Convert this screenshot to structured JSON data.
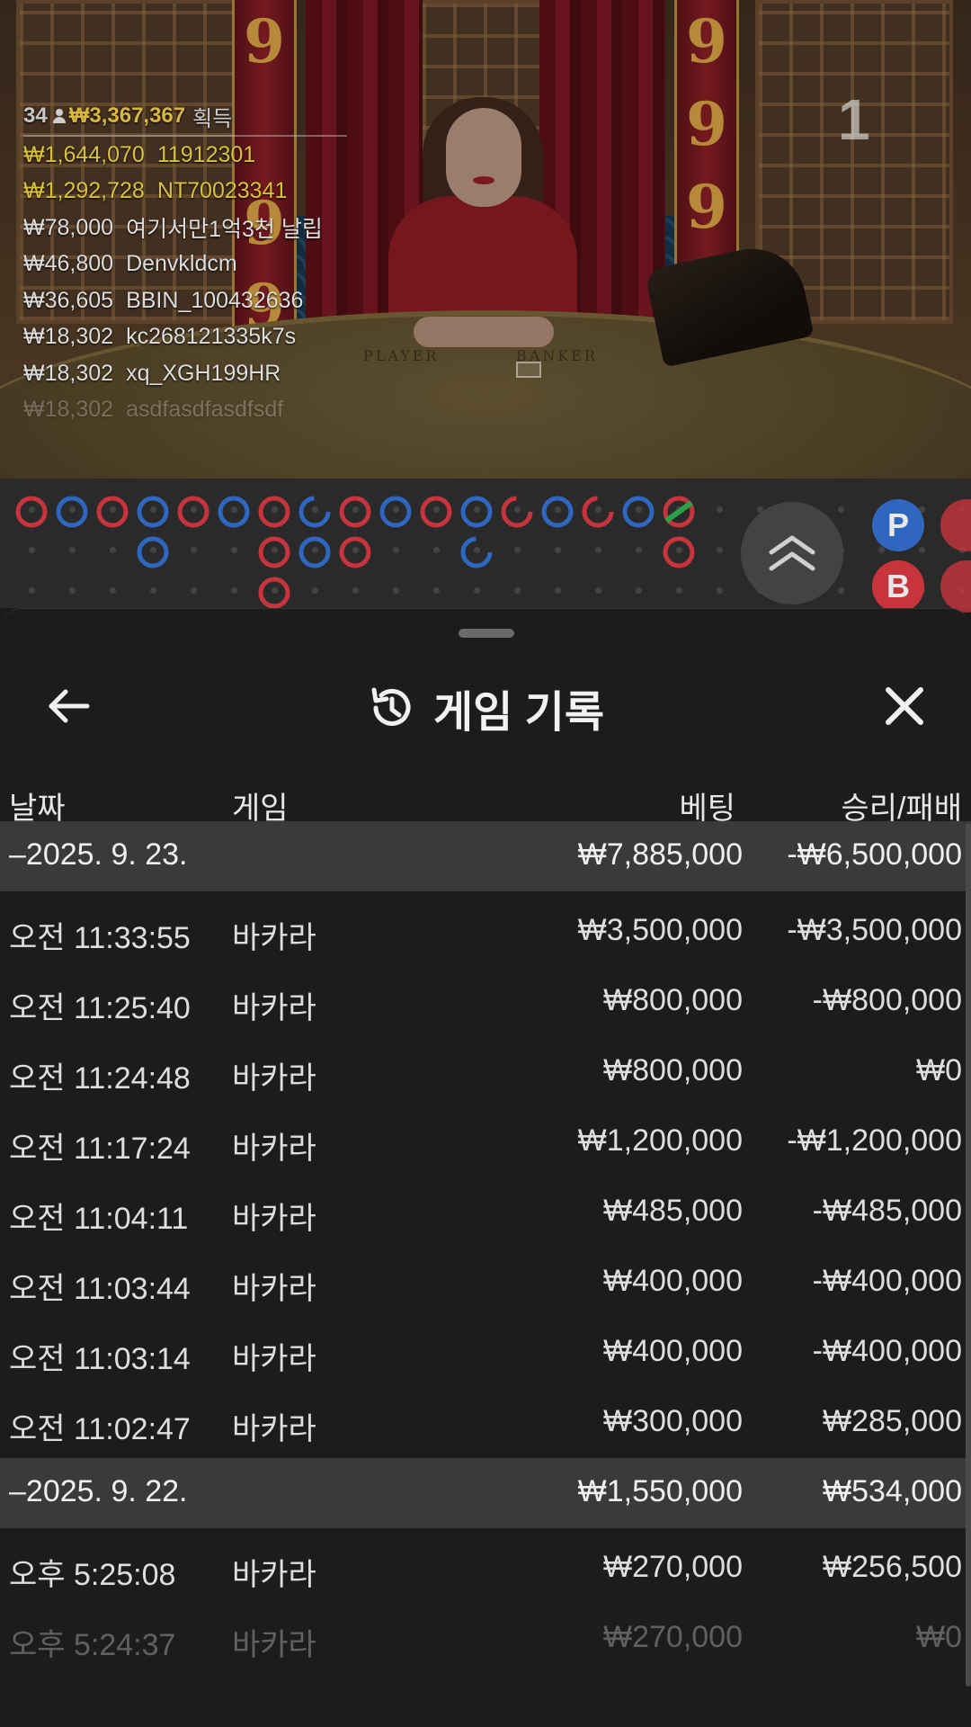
{
  "stream": {
    "round_number": "1",
    "table_labels": {
      "player": "PLAYER",
      "banker": "BANKER"
    },
    "pillar_digits": [
      "9",
      "9",
      "9",
      "9",
      "9",
      "9"
    ]
  },
  "winners": {
    "count": "34",
    "total": "₩3,367,367",
    "suffix": "획득",
    "rows": [
      {
        "amount": "₩1,644,070",
        "name": "11912301",
        "style": "gold"
      },
      {
        "amount": "₩1,292,728",
        "name": "NT70023341",
        "style": "gold"
      },
      {
        "amount": "₩78,000",
        "name": "여기서만1억3천 날립",
        "style": "white"
      },
      {
        "amount": "₩46,800",
        "name": "Denvkldcm",
        "style": "white"
      },
      {
        "amount": "₩36,605",
        "name": "BBIN_100432636",
        "style": "white"
      },
      {
        "amount": "₩18,302",
        "name": "kc268121335k7s",
        "style": "white"
      },
      {
        "amount": "₩18,302",
        "name": "xq_XGH199HR",
        "style": "white"
      },
      {
        "amount": "₩18,302",
        "name": "asdfasdfasdfsdf",
        "style": "fade"
      }
    ]
  },
  "roadmap": {
    "colors": {
      "player": "#2f66c0",
      "banker": "#c8343c",
      "tie": "#2aa04a"
    },
    "predictions": [
      {
        "label": "P",
        "type": "player"
      },
      {
        "label": "B",
        "type": "banker"
      }
    ]
  },
  "history": {
    "title": "게임 기록",
    "columns": {
      "date": "날짜",
      "game": "게임",
      "bet": "베팅",
      "result": "승리/패배"
    },
    "days": [
      {
        "date": "–2025. 9. 23.",
        "bet": "₩7,885,000",
        "result": "-₩6,500,000",
        "rows": [
          {
            "time": "오전 11:33:55",
            "game": "바카라",
            "bet": "₩3,500,000",
            "result": "-₩3,500,000"
          },
          {
            "time": "오전 11:25:40",
            "game": "바카라",
            "bet": "₩800,000",
            "result": "-₩800,000"
          },
          {
            "time": "오전 11:24:48",
            "game": "바카라",
            "bet": "₩800,000",
            "result": "₩0"
          },
          {
            "time": "오전 11:17:24",
            "game": "바카라",
            "bet": "₩1,200,000",
            "result": "-₩1,200,000"
          },
          {
            "time": "오전 11:04:11",
            "game": "바카라",
            "bet": "₩485,000",
            "result": "-₩485,000"
          },
          {
            "time": "오전 11:03:44",
            "game": "바카라",
            "bet": "₩400,000",
            "result": "-₩400,000"
          },
          {
            "time": "오전 11:03:14",
            "game": "바카라",
            "bet": "₩400,000",
            "result": "-₩400,000"
          },
          {
            "time": "오전 11:02:47",
            "game": "바카라",
            "bet": "₩300,000",
            "result": "₩285,000"
          }
        ]
      },
      {
        "date": "–2025. 9. 22.",
        "bet": "₩1,550,000",
        "result": "₩534,000",
        "rows": [
          {
            "time": "오후 5:25:08",
            "game": "바카라",
            "bet": "₩270,000",
            "result": "₩256,500"
          },
          {
            "time": "오후 5:24:37",
            "game": "바카라",
            "bet": "₩270,000",
            "result": "₩0"
          }
        ]
      }
    ]
  }
}
